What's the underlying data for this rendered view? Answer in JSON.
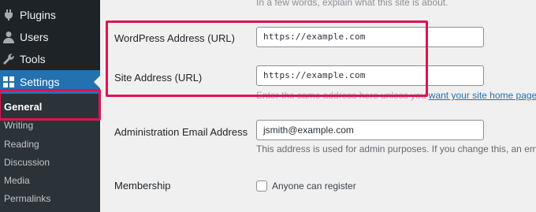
{
  "sidebar": {
    "items": [
      {
        "label": "Plugins",
        "icon": "plug-icon"
      },
      {
        "label": "Users",
        "icon": "user-icon"
      },
      {
        "label": "Tools",
        "icon": "wrench-icon"
      },
      {
        "label": "Settings",
        "icon": "settings-icon",
        "active": true
      }
    ],
    "submenu": [
      {
        "label": "General",
        "active": true
      },
      {
        "label": "Writing"
      },
      {
        "label": "Reading"
      },
      {
        "label": "Discussion"
      },
      {
        "label": "Media"
      },
      {
        "label": "Permalinks"
      }
    ]
  },
  "settings": {
    "tagline_desc": "In a few words, explain what this site is about.",
    "wp_address": {
      "label": "WordPress Address (URL)",
      "value": "https://example.com"
    },
    "site_address": {
      "label": "Site Address (URL)",
      "value": "https://example.com",
      "desc_prefix": "Enter the same address here unless you ",
      "desc_link": "want your site home page to b"
    },
    "admin_email": {
      "label": "Administration Email Address",
      "value": "jsmith@example.com",
      "desc": "This address is used for admin purposes. If you change this, an email w"
    },
    "membership": {
      "label": "Membership",
      "checkbox_label": "Anyone can register",
      "checked": false
    }
  },
  "colors": {
    "highlight": "#e0134f",
    "sidebar_bg": "#1d2327",
    "submenu_bg": "#2c3338",
    "active_menu_bg": "#2271b1"
  }
}
